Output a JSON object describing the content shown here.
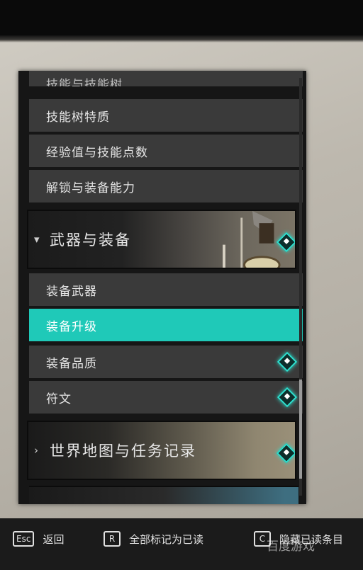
{
  "menu": {
    "cut_item": "技能与技能树",
    "items_top": [
      {
        "label": "技能树特质"
      },
      {
        "label": "经验值与技能点数"
      },
      {
        "label": "解锁与装备能力"
      }
    ],
    "weapons_header": {
      "label": "武器与装备",
      "chevron": "chevron-down-icon"
    },
    "items_weapons": [
      {
        "label": "装备武器",
        "selected": false,
        "new": false
      },
      {
        "label": "装备升级",
        "selected": true,
        "new": false
      },
      {
        "label": "装备品质",
        "selected": false,
        "new": true
      },
      {
        "label": "符文",
        "selected": false,
        "new": true
      }
    ],
    "world_header": {
      "label": "世界地图与任务记录",
      "chevron": "chevron-right-icon"
    }
  },
  "colors": {
    "selected": "#1fc9b8",
    "new_indicator": "#2fe0cf"
  },
  "footer": {
    "back": {
      "key": "Esc",
      "label": "返回"
    },
    "mark_all": {
      "key": "R",
      "label": "全部标记为已读"
    },
    "hide_read": {
      "key": "C",
      "label": "隐藏已读条目"
    },
    "watermark": "百度游戏"
  }
}
